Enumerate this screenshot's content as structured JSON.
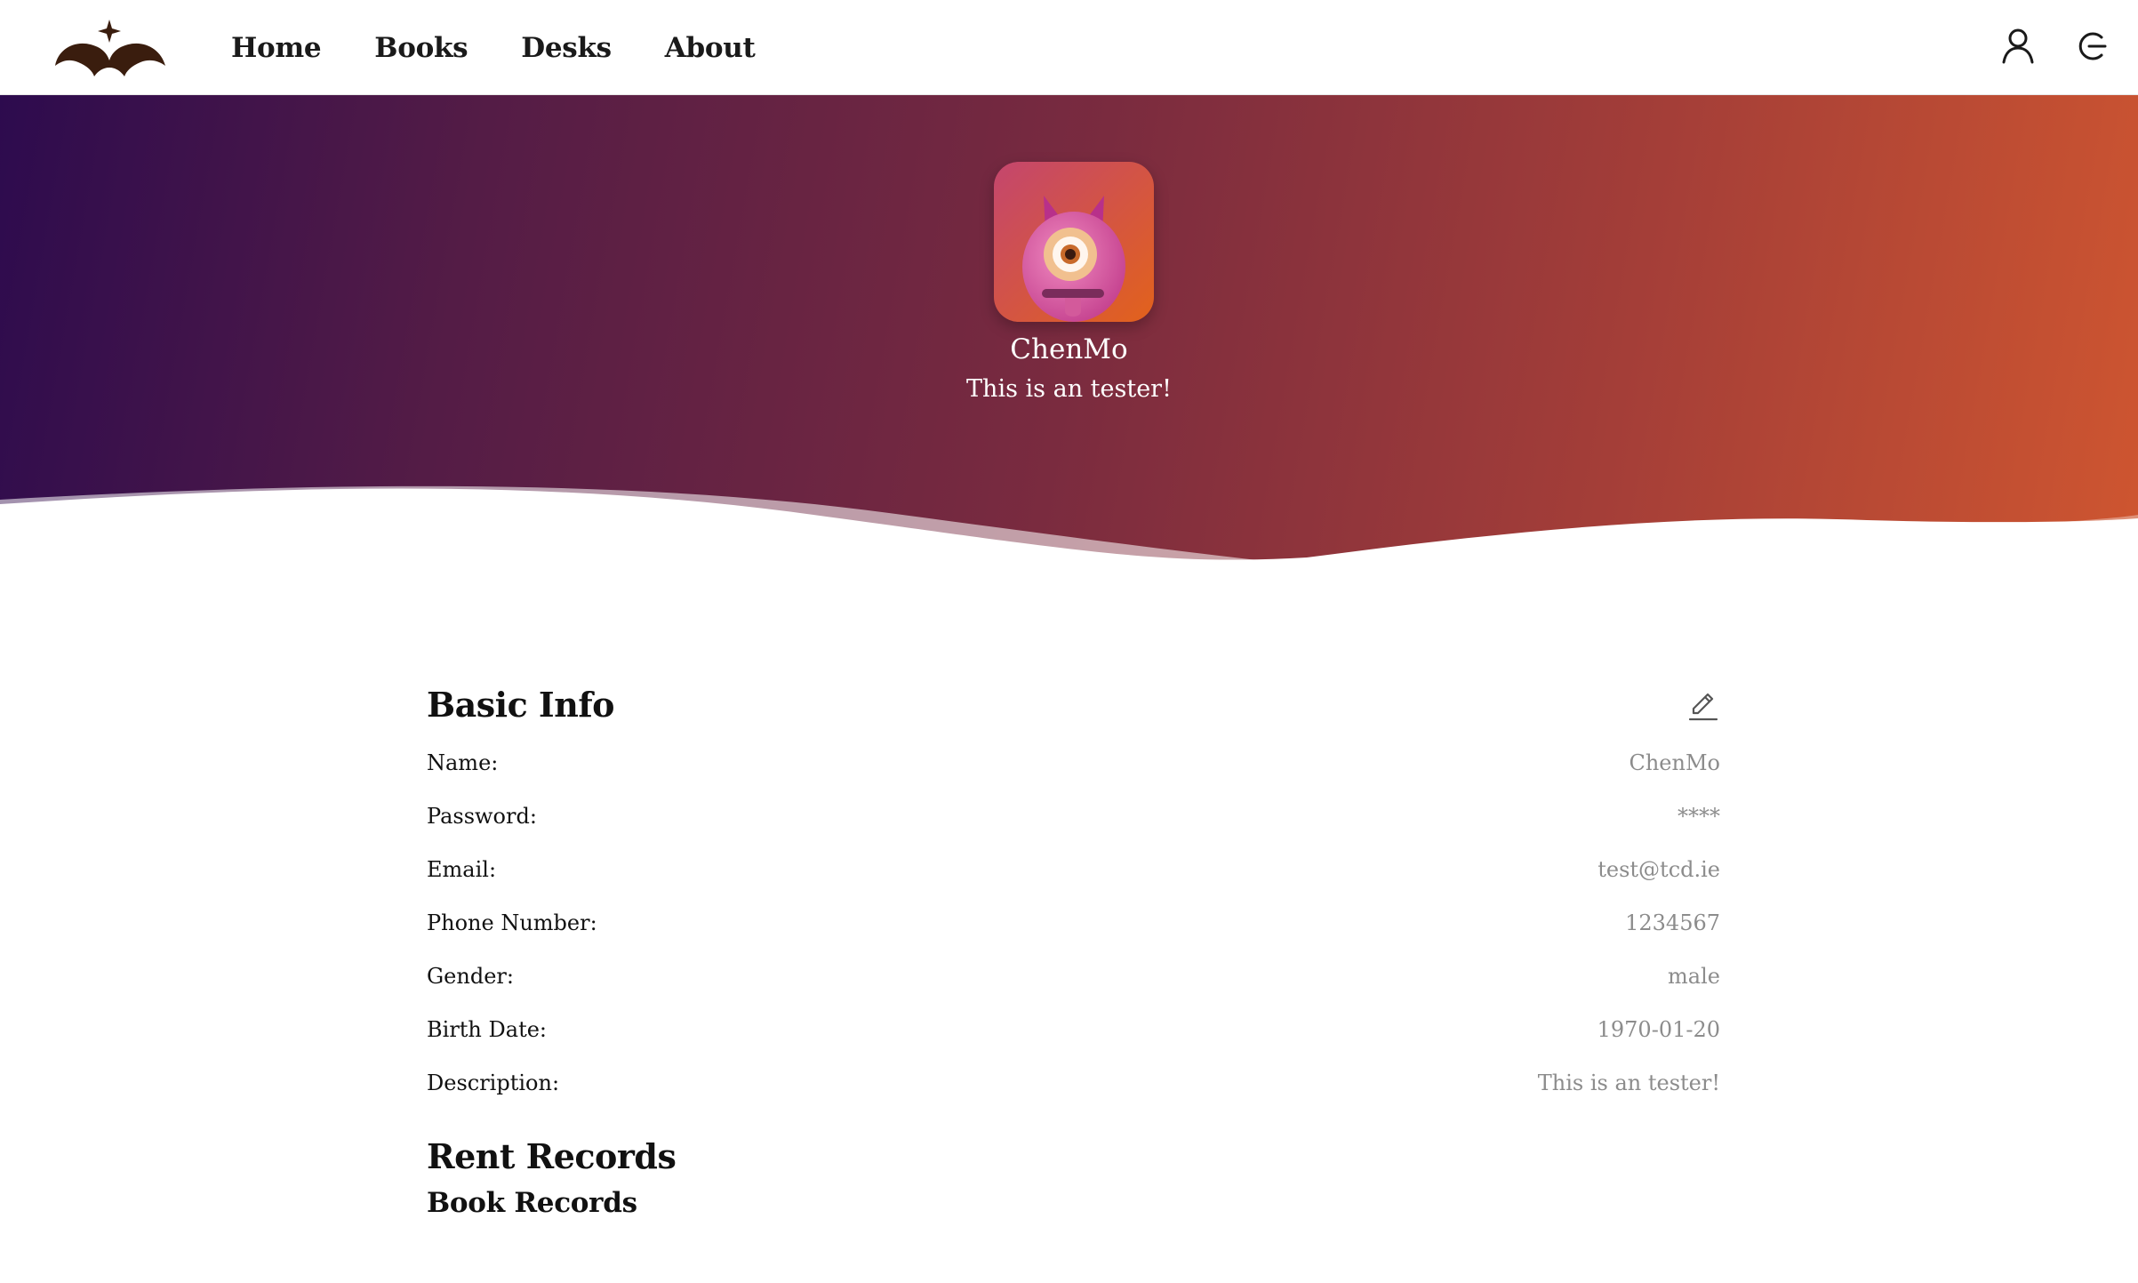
{
  "nav": {
    "links": [
      "Home",
      "Books",
      "Desks",
      "About"
    ],
    "icons": [
      "user-icon",
      "logout-icon"
    ]
  },
  "logo": {
    "icon": "open-book-star-logo",
    "color": "#3a1d0e"
  },
  "profile": {
    "name": "ChenMo",
    "description": "This is an tester!",
    "avatar_icon": "one-eyed-monster-avatar"
  },
  "hero": {
    "gradient_start": "#2d0b4e",
    "gradient_end": "#cf5630"
  },
  "basic_info": {
    "title": "Basic Info",
    "edit_icon": "pencil-icon",
    "rows": [
      {
        "label": "Name:",
        "value": "ChenMo"
      },
      {
        "label": "Password:",
        "value": "****"
      },
      {
        "label": "Email:",
        "value": "test@tcd.ie"
      },
      {
        "label": "Phone Number:",
        "value": "1234567"
      },
      {
        "label": "Gender:",
        "value": "male"
      },
      {
        "label": "Birth Date:",
        "value": "1970-01-20"
      },
      {
        "label": "Description:",
        "value": "This is an tester!"
      }
    ]
  },
  "rent_records": {
    "title": "Rent Records",
    "book_records_title": "Book Records"
  }
}
